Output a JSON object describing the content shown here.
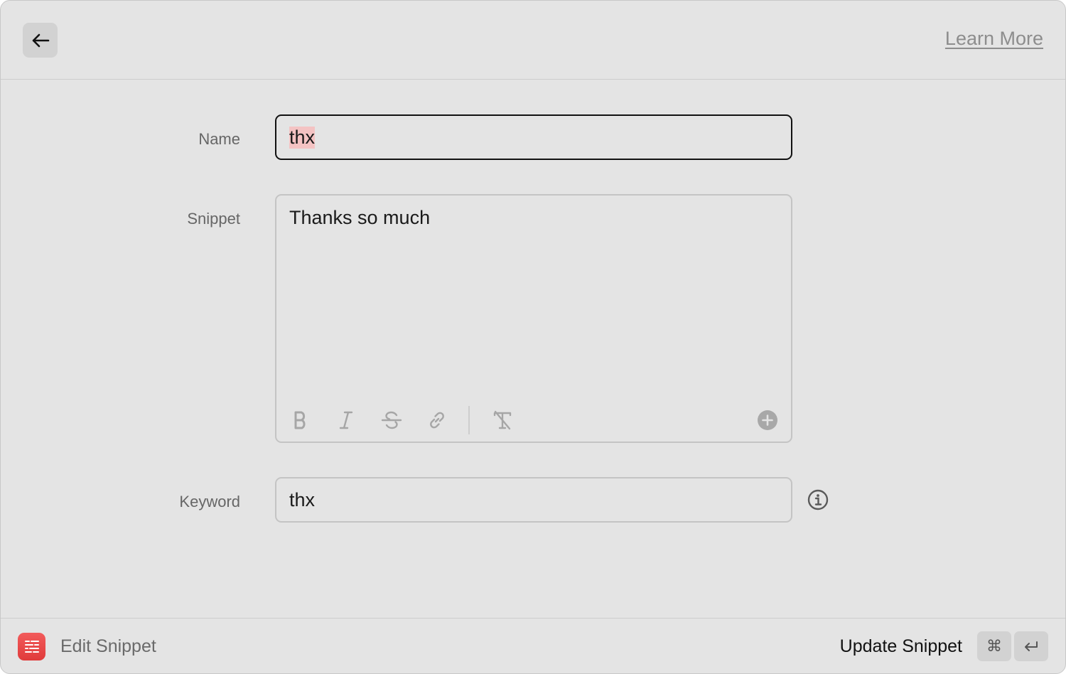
{
  "header": {
    "learn_more": "Learn More"
  },
  "form": {
    "name_label": "Name",
    "name_value": "thx",
    "snippet_label": "Snippet",
    "snippet_value": "Thanks so much",
    "keyword_label": "Keyword",
    "keyword_value": "thx"
  },
  "toolbar": {
    "buttons": [
      "bold",
      "italic",
      "strikethrough",
      "link",
      "clear-formatting",
      "add"
    ]
  },
  "footer": {
    "title": "Edit Snippet",
    "action": "Update Snippet",
    "shortcut_cmd": "⌘",
    "shortcut_enter": "↵"
  },
  "colors": {
    "app_icon": "#e94646",
    "selection": "#f4c3c3",
    "focus_border": "#111111"
  }
}
